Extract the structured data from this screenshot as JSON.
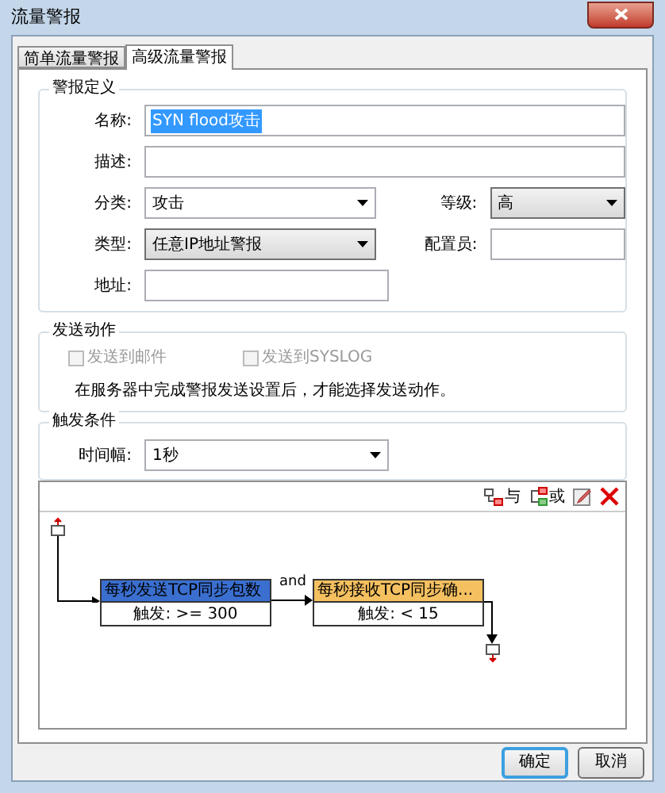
{
  "window": {
    "title": "流量警报"
  },
  "tabs": [
    {
      "label": "简单流量警报",
      "selected": false
    },
    {
      "label": "高级流量警报",
      "selected": true
    }
  ],
  "definition": {
    "title": "警报定义",
    "name": {
      "label": "名称:",
      "value": "SYN flood攻击",
      "highlighted": true
    },
    "description": {
      "label": "描述:"
    },
    "category": {
      "label": "分类:",
      "value": "攻击"
    },
    "level": {
      "label": "等级:",
      "value": "高"
    },
    "type": {
      "label": "类型:",
      "value": "任意IP地址警报"
    },
    "operator": {
      "label": "配置员:"
    },
    "address": {
      "label": "地址:"
    }
  },
  "actions": {
    "title": "发送动作",
    "options": [
      {
        "label": "发送到邮件",
        "checked": false,
        "disabled": true
      },
      {
        "label": "发送到SYSLOG",
        "checked": false,
        "disabled": true
      }
    ],
    "note": "在服务器中完成警报发送设置后，才能选择发送动作。"
  },
  "trigger": {
    "title": "触发条件",
    "interval": {
      "label": "时间幅:",
      "value": "1秒"
    }
  },
  "toolbar": [
    {
      "kind": "and",
      "label": "与"
    },
    {
      "kind": "or",
      "label": "或"
    },
    {
      "kind": "edit"
    },
    {
      "kind": "delete"
    }
  ],
  "diagram": {
    "nodes": [
      {
        "title": "每秒发送TCP同步包数",
        "condition": "触发: >= 300",
        "color": "#3a6fd0"
      },
      {
        "title": "每秒接收TCP同步确...",
        "condition": "触发: < 15",
        "color": "#f5c060"
      }
    ],
    "connector": "and"
  },
  "buttons": [
    {
      "label": "确定",
      "default": true
    },
    {
      "label": "取消",
      "default": false
    }
  ]
}
